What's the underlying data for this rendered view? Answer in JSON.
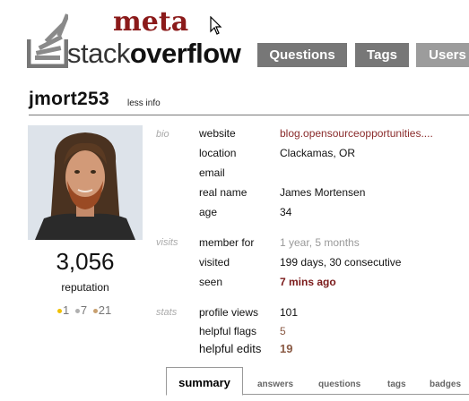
{
  "logo": {
    "meta": "meta",
    "word_light": "stack",
    "word_bold": "overflow"
  },
  "nav": [
    {
      "label": "Questions"
    },
    {
      "label": "Tags"
    },
    {
      "label": "Users"
    }
  ],
  "user": {
    "name": "jmort253",
    "less_info": "less info",
    "reputation": "3,056",
    "reputation_label": "reputation",
    "badges": {
      "gold": "1",
      "silver": "7",
      "bronze": "21"
    },
    "colors": {
      "gold": "#f0c000",
      "silver": "#b0b0b0",
      "bronze": "#c8a070"
    }
  },
  "details": {
    "bio_section": "bio",
    "visits_section": "visits",
    "stats_section": "stats",
    "rows": [
      {
        "label": "website",
        "value": "blog.opensourceopportunities...."
      },
      {
        "label": "location",
        "value": "Clackamas, OR"
      },
      {
        "label": "email",
        "value": ""
      },
      {
        "label": "real name",
        "value": "James Mortensen"
      },
      {
        "label": "age",
        "value": "34"
      },
      {
        "label": "member for",
        "value": "1 year, 5 months"
      },
      {
        "label": "visited",
        "value": "199 days, 30 consecutive"
      },
      {
        "label": "seen",
        "value": "7 mins ago"
      },
      {
        "label": "profile views",
        "value": "101"
      },
      {
        "label": "helpful flags",
        "value": "5"
      },
      {
        "label": "helpful edits",
        "value": "19"
      }
    ]
  },
  "tabs": [
    {
      "label": "summary"
    },
    {
      "label": "answers"
    },
    {
      "label": "questions"
    },
    {
      "label": "tags"
    },
    {
      "label": "badges"
    }
  ]
}
